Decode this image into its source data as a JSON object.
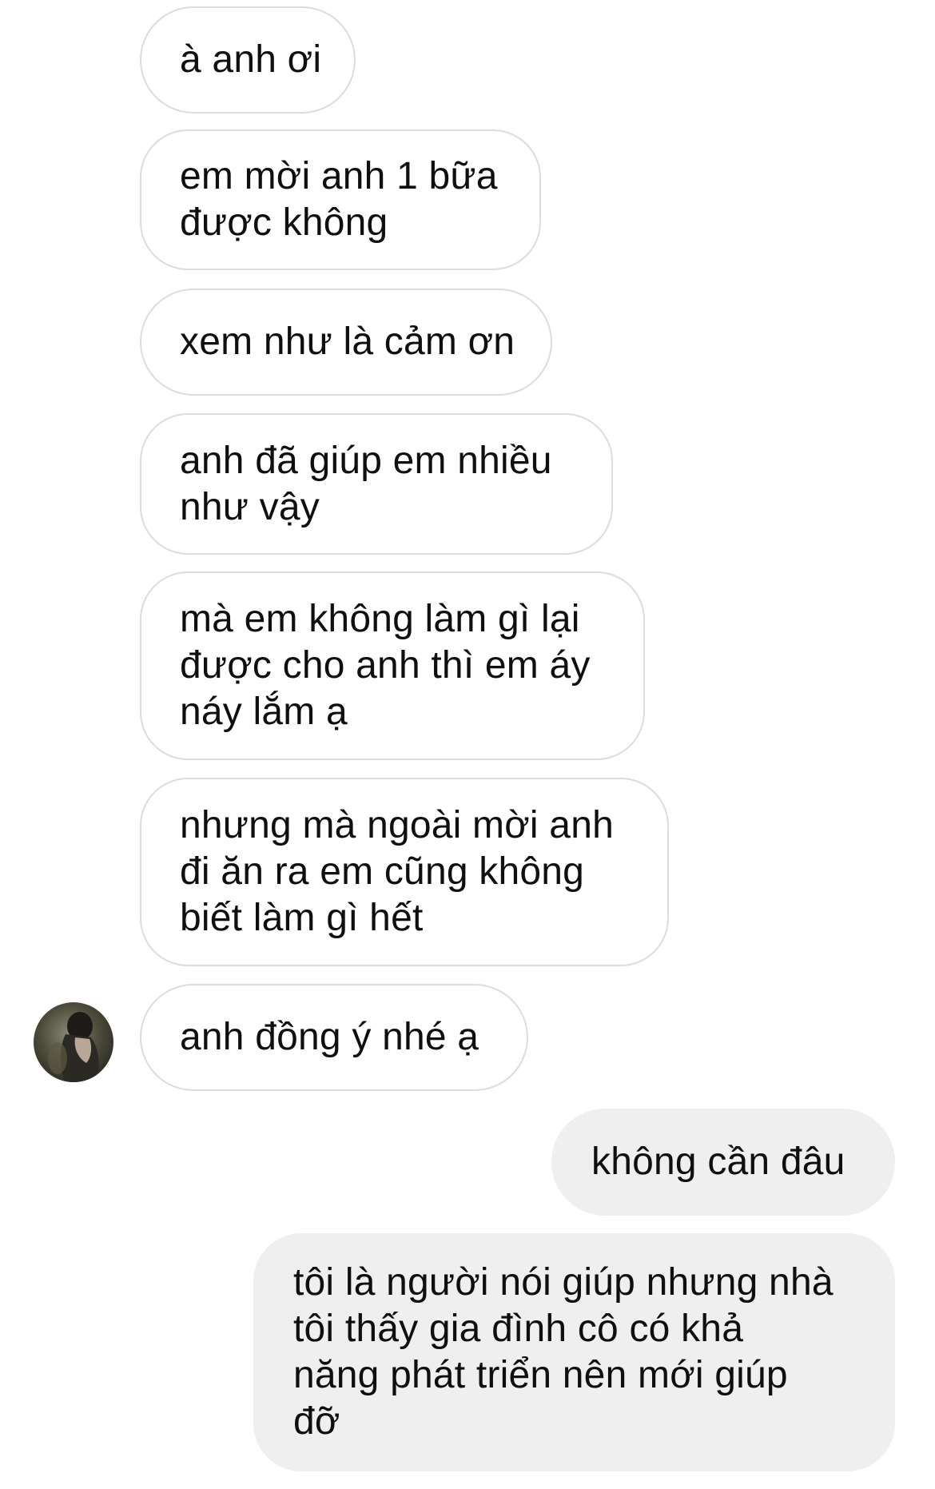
{
  "thread": {
    "messages": [
      {
        "sender": "other",
        "text": "à anh ơi"
      },
      {
        "sender": "other",
        "text": "em mời anh 1 bữa\nđược không"
      },
      {
        "sender": "other",
        "text": "xem như là cảm ơn"
      },
      {
        "sender": "other",
        "text": "anh đã giúp em nhiều\nnhư vậy"
      },
      {
        "sender": "other",
        "text": "mà em không làm gì lại\nđược cho anh thì em áy\nnáy lắm ạ"
      },
      {
        "sender": "other",
        "text": "nhưng mà ngoài mời anh\nđi ăn ra em cũng không\nbiết làm gì hết"
      },
      {
        "sender": "other",
        "text": "anh đồng ý nhé ạ"
      },
      {
        "sender": "me",
        "text": "không cần đâu"
      },
      {
        "sender": "me",
        "text": "tôi là người nói giúp nhưng nhà\ntôi thấy gia đình cô có khả\nnăng phát triển nên mới giúp\nđỡ"
      }
    ]
  },
  "colors": {
    "incoming_bg": "#ffffff",
    "incoming_border": "#dcdcdc",
    "outgoing_bg": "#efefef",
    "text": "#0f0f0f"
  },
  "icons": {
    "avatar": "avatar-photo"
  }
}
